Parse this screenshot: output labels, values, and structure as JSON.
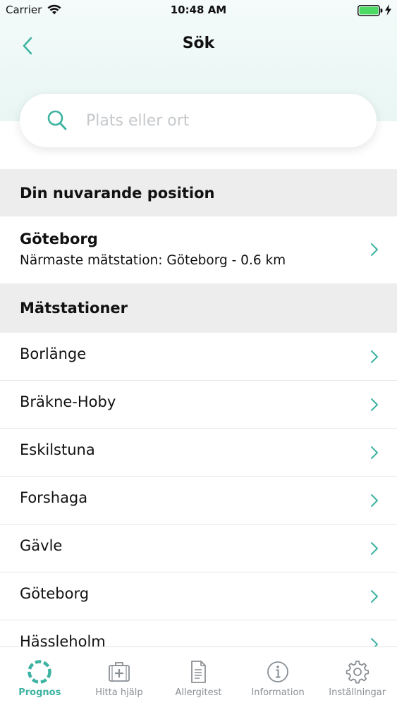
{
  "status_bar": {
    "carrier": "Carrier",
    "time": "10:48 AM"
  },
  "header": {
    "title": "Sök"
  },
  "search": {
    "placeholder": "Plats eller ort",
    "value": ""
  },
  "current_position": {
    "section_title": "Din nuvarande position",
    "city": "Göteborg",
    "nearest": "Närmaste mätstation: Göteborg - 0.6 km"
  },
  "stations": {
    "section_title": "Mätstationer",
    "items": [
      {
        "label": "Borlänge"
      },
      {
        "label": "Bräkne-Hoby"
      },
      {
        "label": "Eskilstuna"
      },
      {
        "label": "Forshaga"
      },
      {
        "label": "Gävle"
      },
      {
        "label": "Göteborg"
      },
      {
        "label": "Hässleholm"
      }
    ]
  },
  "tab_bar": {
    "tabs": [
      {
        "label": "Prognos",
        "icon": "prognos-icon",
        "active": true
      },
      {
        "label": "Hitta hjälp",
        "icon": "first-aid-kit-icon",
        "active": false
      },
      {
        "label": "Allergitest",
        "icon": "document-icon",
        "active": false
      },
      {
        "label": "Information",
        "icon": "info-icon",
        "active": false
      },
      {
        "label": "Inställningar",
        "icon": "gear-icon",
        "active": false
      }
    ]
  },
  "colors": {
    "accent": "#3eb3a1",
    "section_bg": "#ededee",
    "header_gradient_top": "#f4fbfa",
    "header_gradient_bottom": "#e4f4f1",
    "battery": "#4cd964"
  }
}
